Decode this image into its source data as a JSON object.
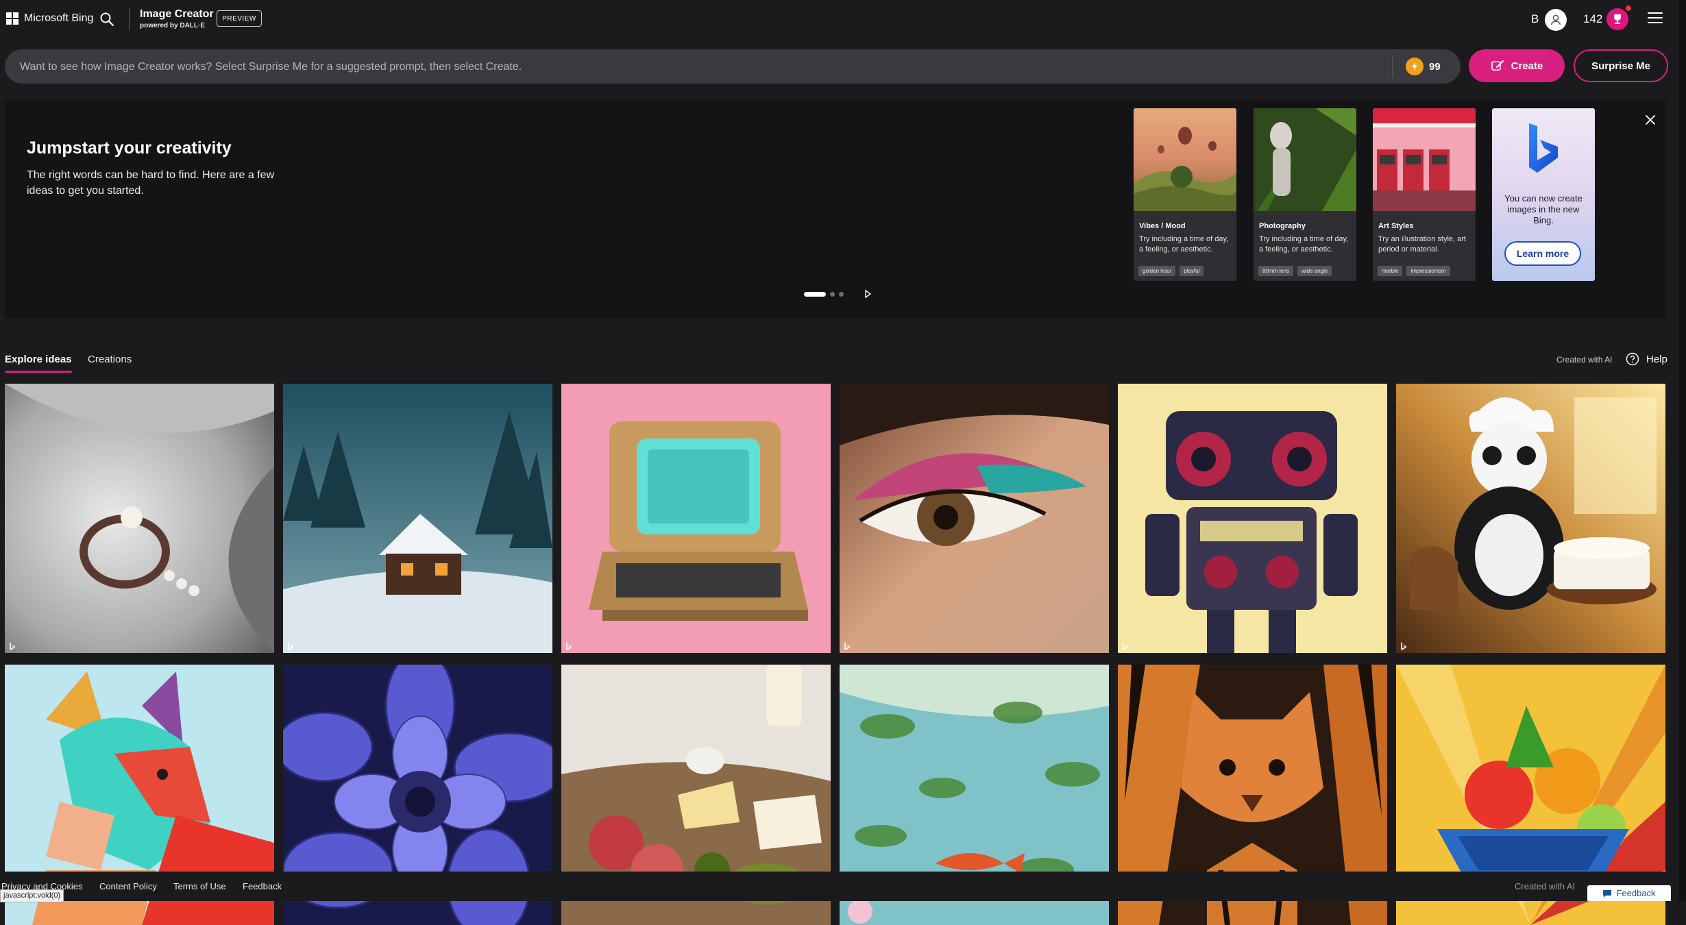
{
  "header": {
    "brand": "Microsoft Bing",
    "app_title": "Image Creator",
    "app_subtitle": "powered by DALL·E",
    "badge": "PREVIEW",
    "user_initial": "B",
    "points": "142"
  },
  "prompt": {
    "placeholder": "Want to see how Image Creator works? Select Surprise Me for a suggested prompt, then select Create.",
    "boosts": "99",
    "create_label": "Create",
    "surprise_label": "Surprise Me"
  },
  "jumpstart": {
    "title": "Jumpstart your creativity",
    "text": "The right words can be hard to find. Here are a few ideas to get you started.",
    "cards": [
      {
        "title": "Vibes / Mood",
        "desc": "Try including a time of day, a feeling, or aesthetic.",
        "chips": [
          "golden hour",
          "playful"
        ]
      },
      {
        "title": "Photography",
        "desc": "Try including a time of day, a feeling, or aesthetic.",
        "chips": [
          "80mm lens",
          "wide angle"
        ]
      },
      {
        "title": "Art Styles",
        "desc": "Try an illustration style, art period or material.",
        "chips": [
          "marble",
          "impressionism"
        ]
      }
    ],
    "bing_text": "You can now create images in the new Bing.",
    "learn_more": "Learn more"
  },
  "tabs": {
    "explore": "Explore ideas",
    "creations": "Creations"
  },
  "meta": {
    "created_with_ai": "Created with AI",
    "help": "Help"
  },
  "footer": {
    "privacy": "Privacy and Cookies",
    "content_policy": "Content Policy",
    "terms": "Terms of Use",
    "feedback": "Feedback",
    "created_with_ai": "Created with AI",
    "feedback_button": "Feedback",
    "status_url": "javascript:void(0)"
  },
  "icons": [
    "windows-logo-icon",
    "search-icon",
    "user-icon",
    "rewards-trophy-icon",
    "menu-icon",
    "boost-bolt-icon",
    "paint-brush-icon",
    "close-icon",
    "chevron-right-icon",
    "help-icon",
    "bing-logo-icon",
    "feedback-icon"
  ],
  "colors": {
    "accent": "#d9207e",
    "background": "#1b1a1d",
    "panel": "#141416",
    "boost": "#f0a21a",
    "link_blue": "#1a4fc0"
  }
}
